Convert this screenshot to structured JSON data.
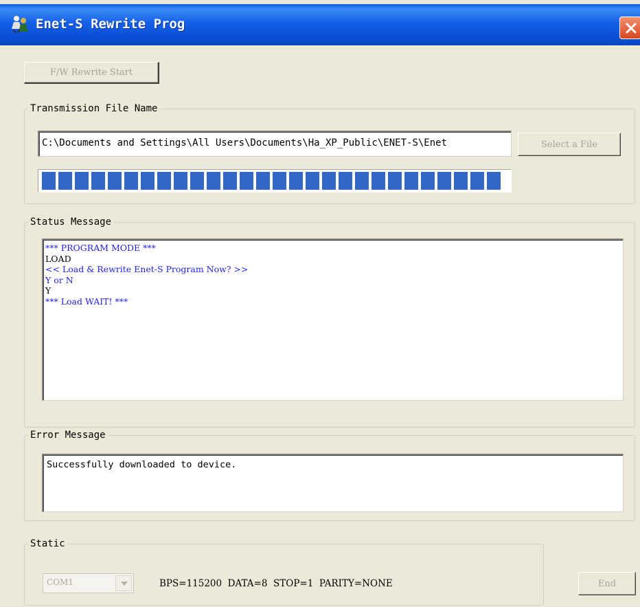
{
  "window": {
    "title": "Enet-S Rewrite Prog",
    "title_bar_color": "#1560e8"
  },
  "toolbar": {
    "rewrite_start_label": "F/W Rewrite Start"
  },
  "transmission": {
    "legend": "Transmission File Name",
    "file_path": "C:\\Documents and Settings\\All Users\\Documents\\Ha_XP_Public\\ENET-S\\Enet",
    "select_file_label": "Select a File",
    "progress_fraction": 1.0,
    "progress_color": "#3167c9"
  },
  "status": {
    "legend": "Status Message",
    "lines": [
      {
        "text": "*** PROGRAM MODE ***",
        "color": "blue"
      },
      {
        "text": "LOAD",
        "color": "black"
      },
      {
        "text": "<< Load & Rewrite Enet-S Program Now? >>",
        "color": "blue"
      },
      {
        "text": "Y or N",
        "color": "blue"
      },
      {
        "text": "Y",
        "color": "black"
      },
      {
        "text": "*** Load WAIT! ***",
        "color": "blue"
      }
    ]
  },
  "error": {
    "legend": "Error Message",
    "text": "Successfully downloaded to device."
  },
  "static": {
    "legend": "Static",
    "port_value": "COM1",
    "info": "BPS=115200  DATA=8  STOP=1  PARITY=NONE"
  },
  "footer": {
    "end_label": "End"
  },
  "icons": {
    "app": "app-people-icon",
    "close": "close-icon",
    "dropdown": "chevron-down-icon"
  }
}
